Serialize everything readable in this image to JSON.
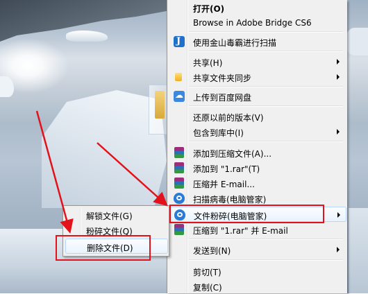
{
  "context_menu": {
    "items": [
      {
        "label": "打开(O)",
        "bold": true
      },
      {
        "label": "Browse in Adobe Bridge CS6"
      },
      {
        "label": "使用金山毒霸进行扫描",
        "icon": "jinshan-icon"
      },
      {
        "label": "共享(H)",
        "submenu": true
      },
      {
        "label": "共享文件夹同步",
        "icon": "share-sync-icon",
        "submenu": true
      },
      {
        "label": "上传到百度网盘",
        "icon": "baidu-netdisk-icon"
      },
      {
        "label": "还原以前的版本(V)"
      },
      {
        "label": "包含到库中(I)",
        "submenu": true
      },
      {
        "label": "添加到压缩文件(A)...",
        "icon": "winrar-icon"
      },
      {
        "label": "添加到 \"1.rar\"(T)",
        "icon": "winrar-icon"
      },
      {
        "label": "压缩并 E-mail...",
        "icon": "winrar-icon"
      },
      {
        "label": "扫描病毒(电脑管家)",
        "icon": "tencent-guard-icon"
      },
      {
        "label": "文件粉碎(电脑管家)",
        "icon": "tencent-guard-icon",
        "submenu": true,
        "highlighted": true
      },
      {
        "label": "压缩到 \"1.rar\" 并 E-mail",
        "icon": "winrar-icon"
      },
      {
        "label": "发送到(N)",
        "submenu": true
      },
      {
        "label": "剪切(T)"
      },
      {
        "label": "复制(C)"
      }
    ]
  },
  "submenu": {
    "items": [
      {
        "label": "解锁文件(G)"
      },
      {
        "label": "粉碎文件(Q)"
      },
      {
        "label": "删除文件(D)",
        "highlighted": true
      }
    ]
  },
  "annotation": {
    "color": "#e3121a"
  }
}
